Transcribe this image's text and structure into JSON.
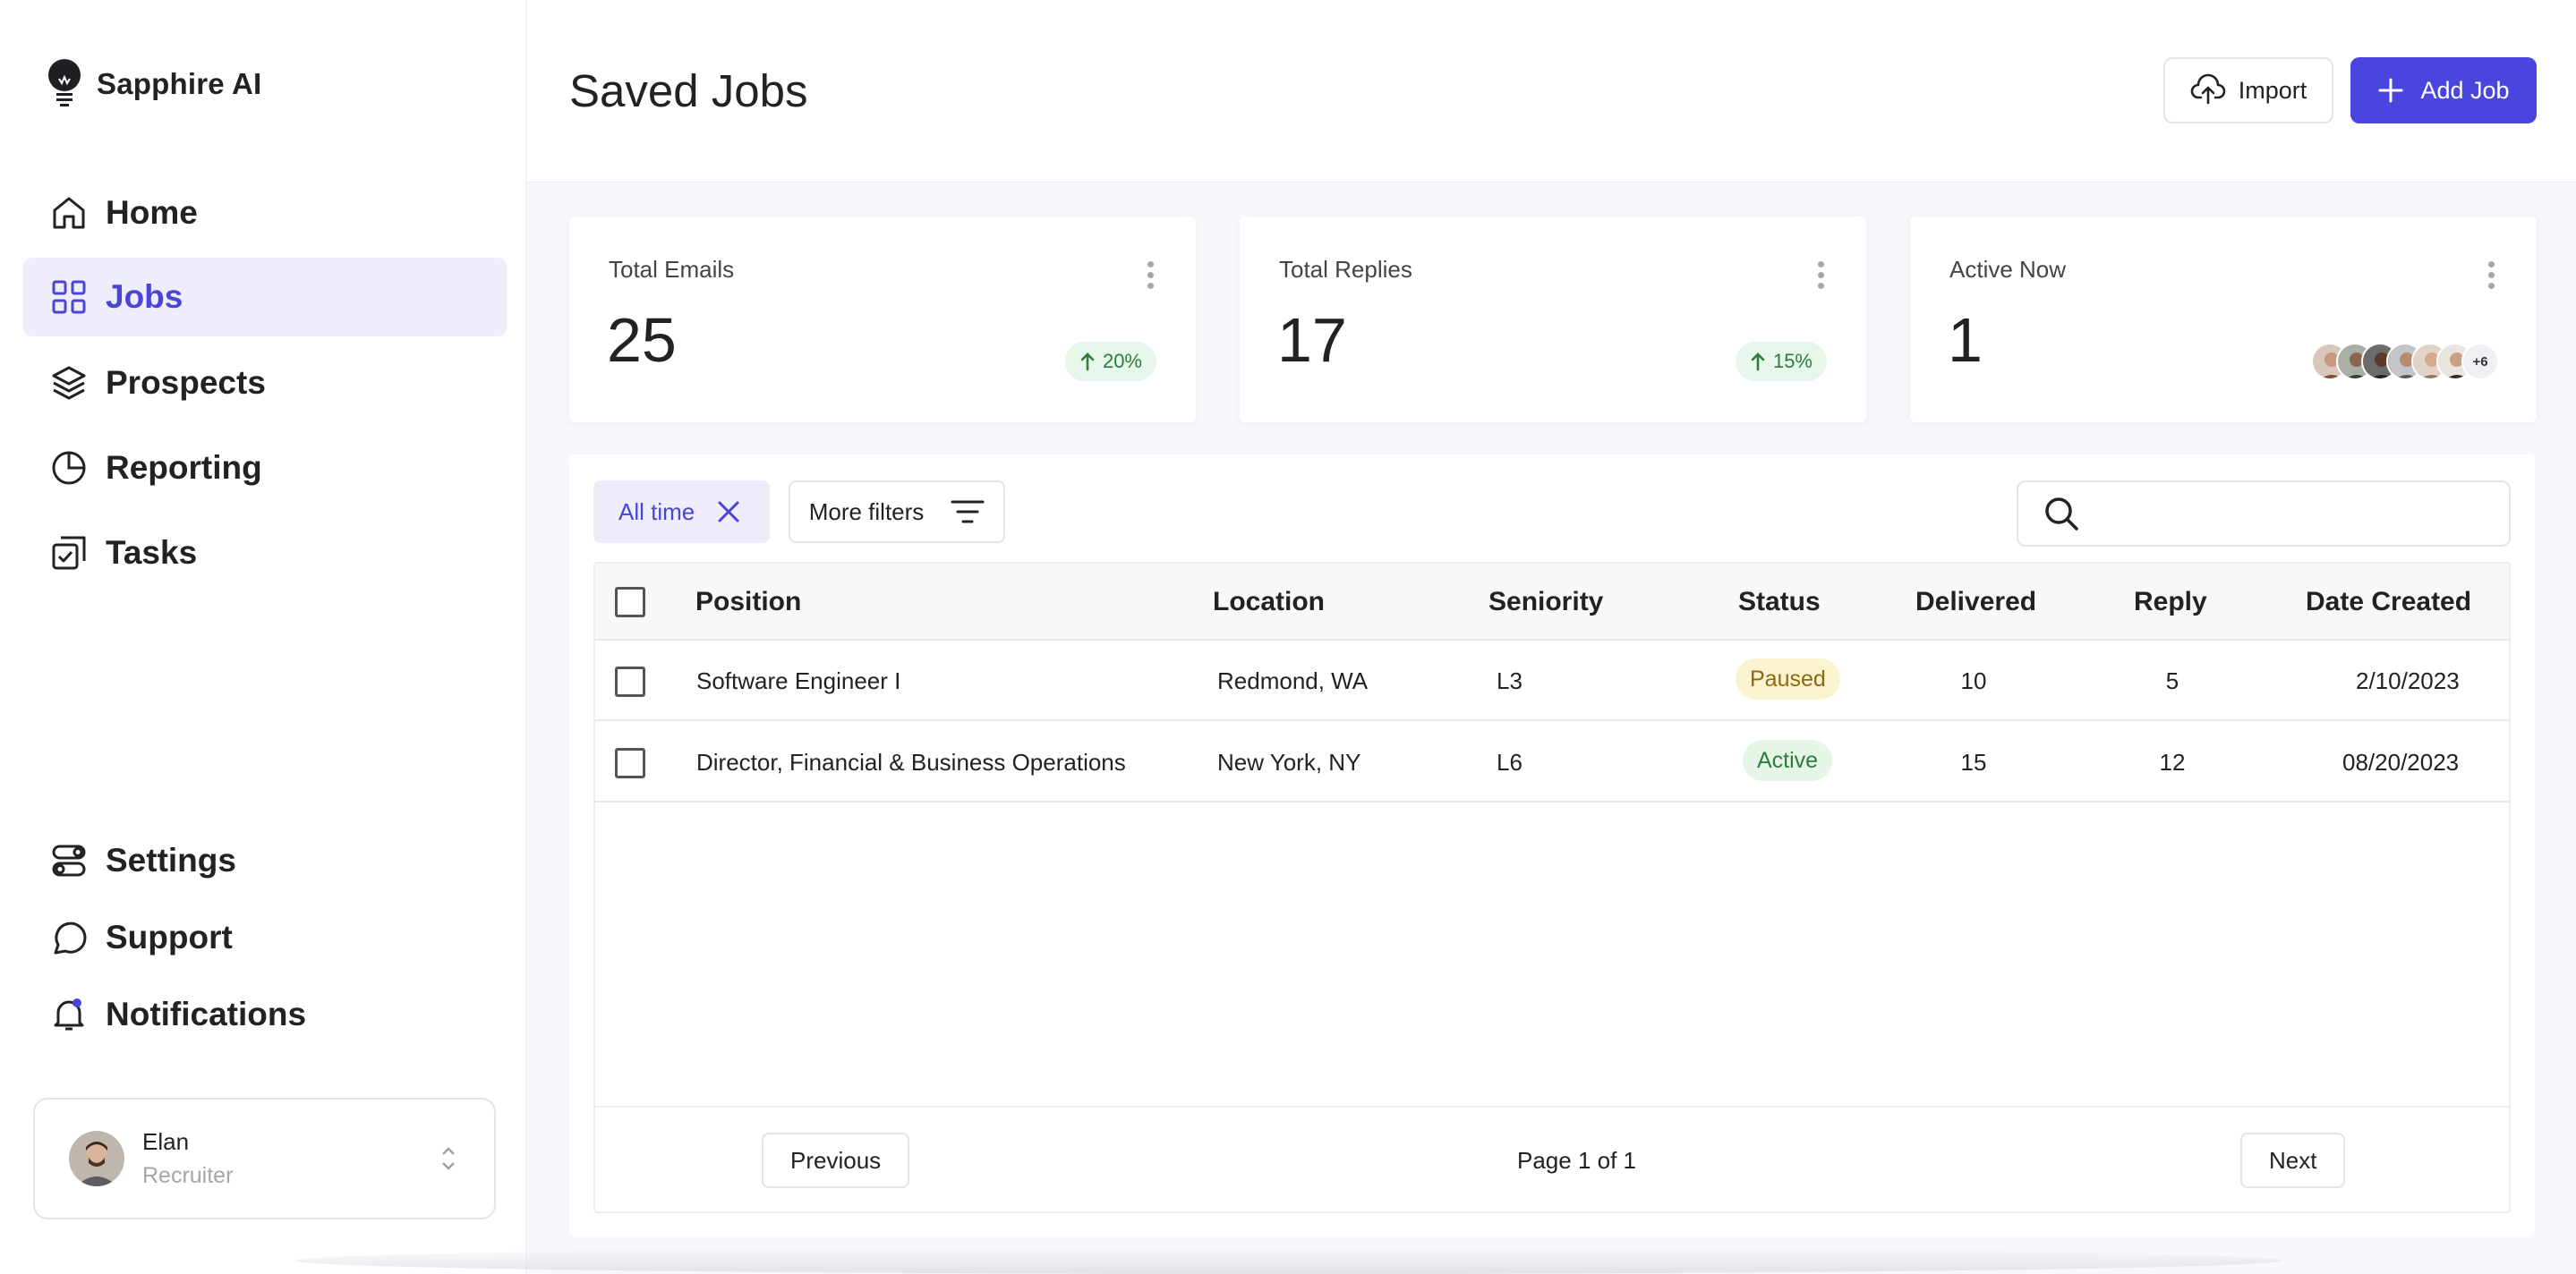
{
  "brand": {
    "name": "Sapphire AI",
    "icon": "lightbulb-icon"
  },
  "nav": {
    "items": [
      {
        "label": "Home",
        "icon": "home-icon"
      },
      {
        "label": "Jobs",
        "icon": "grid-icon",
        "active": true
      },
      {
        "label": "Prospects",
        "icon": "layers-icon"
      },
      {
        "label": "Reporting",
        "icon": "pie-chart-icon"
      },
      {
        "label": "Tasks",
        "icon": "tasks-icon"
      }
    ],
    "bottom_items": [
      {
        "label": "Settings",
        "icon": "toggles-icon"
      },
      {
        "label": "Support",
        "icon": "chat-bubble-icon"
      },
      {
        "label": "Notifications",
        "icon": "bell-icon"
      }
    ]
  },
  "user": {
    "name": "Elan",
    "role": "Recruiter"
  },
  "header": {
    "title": "Saved Jobs",
    "import_label": "Import",
    "add_label": "Add Job"
  },
  "stats": [
    {
      "label": "Total Emails",
      "value": "25",
      "trend": "20%"
    },
    {
      "label": "Total Replies",
      "value": "17",
      "trend": "15%"
    },
    {
      "label": "Active Now",
      "value": "1",
      "extra_avatars": "+6"
    }
  ],
  "filters": {
    "chip_label": "All time",
    "more_label": "More filters",
    "search_placeholder": ""
  },
  "table": {
    "columns": [
      "Position",
      "Location",
      "Seniority",
      "Status",
      "Delivered",
      "Reply",
      "Date Created"
    ],
    "rows": [
      {
        "position": "Software Engineer I",
        "location": "Redmond, WA",
        "seniority": "L3",
        "status": "Paused",
        "delivered": "10",
        "reply": "5",
        "date": "2/10/2023"
      },
      {
        "position": "Director, Financial & Business Operations",
        "location": "New York, NY",
        "seniority": "L6",
        "status": "Active",
        "delivered": "15",
        "reply": "12",
        "date": "08/20/2023"
      }
    ]
  },
  "pagination": {
    "previous": "Previous",
    "info": "Page 1 of 1",
    "next": "Next"
  },
  "colors": {
    "accent": "#4b45e0",
    "active_bg": "#eeedfb",
    "paused": "#fbf3cf",
    "active_badge": "#e5f5e7"
  }
}
